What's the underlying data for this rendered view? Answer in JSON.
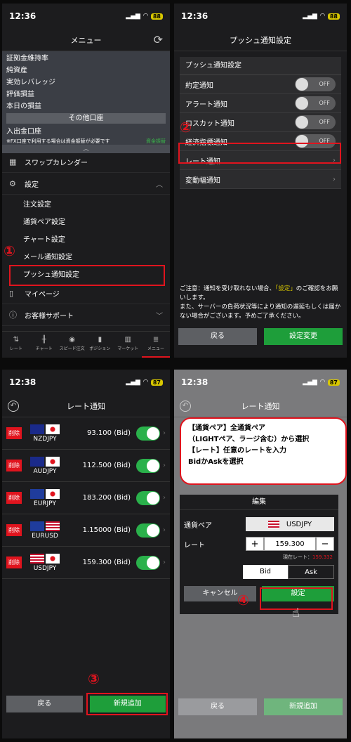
{
  "panel1": {
    "time": "12:36",
    "battery": "88",
    "title": "メニュー",
    "info_rows": [
      "証拠金維持率",
      "純資産",
      "実効レバレッジ",
      "評価損益",
      "本日の損益"
    ],
    "other_account": "その他口座",
    "deposit": "入出金口座",
    "note": "※FX口座で利用する場合は資金振替が必要です",
    "note_link": "資金振替",
    "menu": {
      "swap": "スワップカレンダー",
      "settings": "設定",
      "order": "注文設定",
      "pair": "通貨ペア設定",
      "chart": "チャート設定",
      "mail": "メール通知設定",
      "push": "プッシュ通知設定",
      "mypage": "マイページ",
      "support": "お客様サポート"
    },
    "tabs": [
      "レート",
      "チャート",
      "スピード注文",
      "ポジション",
      "マーケット",
      "メニュー"
    ],
    "step": "①"
  },
  "panel2": {
    "time": "12:36",
    "battery": "88",
    "title": "プッシュ通知設定",
    "section": "プッシュ通知設定",
    "items": [
      "約定通知",
      "アラート通知",
      "ロスカット通知",
      "経済指標通知"
    ],
    "off_label": "OFF",
    "rate_notice": "レート通知",
    "change_notice": "変動幅通知",
    "caution_pre": "ご注意：通知を受け取れない場合、",
    "caution_link": "「設定」",
    "caution_post": "のご確認をお願いします。\nまた、サーバーの負荷状況等により通知の遅延もしくは届かない場合がございます。予めご了承ください。",
    "back": "戻る",
    "save": "設定変更",
    "step": "②"
  },
  "panel3": {
    "time": "12:38",
    "battery": "87",
    "title": "レート通知",
    "delete": "削除",
    "rows": [
      {
        "pair": "NZDJPY",
        "value": "93.100 (Bid)"
      },
      {
        "pair": "AUDJPY",
        "value": "112.500 (Bid)"
      },
      {
        "pair": "EURJPY",
        "value": "183.200 (Bid)"
      },
      {
        "pair": "EURUSD",
        "value": "1.15000 (Bid)"
      },
      {
        "pair": "USDJPY",
        "value": "159.300 (Bid)"
      }
    ],
    "back": "戻る",
    "add": "新規追加",
    "step": "③"
  },
  "panel4": {
    "time": "12:38",
    "battery": "87",
    "title": "レート通知",
    "bubble": [
      "【通貨ペア】全通貨ペア",
      "（LIGHTペア、ラージ含む）から選択",
      "【レート】任意のレートを入力",
      "BidかAskを選択"
    ],
    "dialog_title": "編集",
    "pair_label": "通貨ペア",
    "pair_value": "USDJPY",
    "rate_label": "レート",
    "rate_value": "159.300",
    "current_label": "現在レート：",
    "current_value": "159.332",
    "bid": "Bid",
    "ask": "Ask",
    "cancel": "キャンセル",
    "set": "設定",
    "back": "戻る",
    "add": "新規追加",
    "step": "④"
  }
}
